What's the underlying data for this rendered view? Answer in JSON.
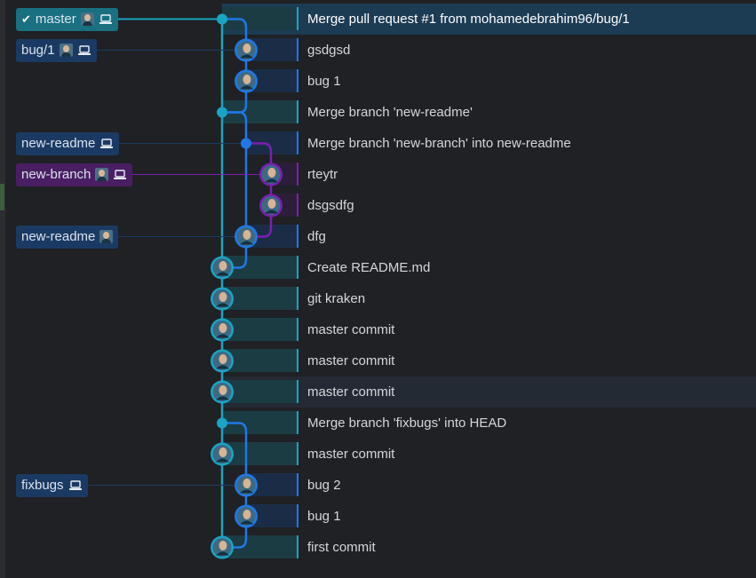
{
  "colors": {
    "background": "#1f2124",
    "lane_master": "#1aa4c4",
    "lane_blue": "#1f78e6",
    "lane_purple": "#7b1fb3",
    "lane_master_cell": "#1c3c44",
    "lane_blue_cell": "#1b2d46",
    "lane_purple_cell": "#2a1e38",
    "tag_master_bg": "#197080",
    "tag_blue_bg": "#1b3a63",
    "tag_purple_bg": "#4a1e63",
    "selected_row_bg": "#1c3c54",
    "hover_row_bg": "#242a33"
  },
  "branch_tags": [
    {
      "row": 0,
      "label": "master",
      "checked": true,
      "avatar": true,
      "laptop": true,
      "kind": "master"
    },
    {
      "row": 1,
      "label": "bug/1",
      "checked": false,
      "avatar": true,
      "laptop": true,
      "kind": "blue"
    },
    {
      "row": 4,
      "label": "new-readme",
      "checked": false,
      "avatar": false,
      "laptop": true,
      "kind": "blue"
    },
    {
      "row": 5,
      "label": "new-branch",
      "checked": false,
      "avatar": true,
      "laptop": true,
      "kind": "purple"
    },
    {
      "row": 7,
      "label": "new-readme",
      "checked": false,
      "avatar": true,
      "laptop": false,
      "kind": "blue"
    },
    {
      "row": 15,
      "label": "fixbugs",
      "checked": false,
      "avatar": false,
      "laptop": true,
      "kind": "blue"
    }
  ],
  "commits": [
    {
      "message": "Merge pull request #1 from mohamedebrahim96/bug/1",
      "lane": 0,
      "merge": true,
      "color": "master",
      "selected": true
    },
    {
      "message": "gsdgsd",
      "lane": 1,
      "merge": false,
      "color": "blue"
    },
    {
      "message": "bug 1",
      "lane": 1,
      "merge": false,
      "color": "blue"
    },
    {
      "message": "Merge branch 'new-readme'",
      "lane": 0,
      "merge": true,
      "color": "master"
    },
    {
      "message": "Merge branch 'new-branch' into new-readme",
      "lane": 1,
      "merge": true,
      "color": "blue"
    },
    {
      "message": "rteytr",
      "lane": 2,
      "merge": false,
      "color": "purple"
    },
    {
      "message": "dsgsdfg",
      "lane": 2,
      "merge": false,
      "color": "purple"
    },
    {
      "message": "dfg",
      "lane": 1,
      "merge": false,
      "color": "blue"
    },
    {
      "message": "Create README.md",
      "lane": 0,
      "merge": false,
      "color": "master"
    },
    {
      "message": "git kraken",
      "lane": 0,
      "merge": false,
      "color": "master"
    },
    {
      "message": "master commit",
      "lane": 0,
      "merge": false,
      "color": "master"
    },
    {
      "message": "master commit",
      "lane": 0,
      "merge": false,
      "color": "master"
    },
    {
      "message": "master commit",
      "lane": 0,
      "merge": false,
      "color": "master",
      "hover": true
    },
    {
      "message": "Merge branch 'fixbugs' into HEAD",
      "lane": 0,
      "merge": true,
      "color": "master"
    },
    {
      "message": "master commit",
      "lane": 0,
      "merge": false,
      "color": "master"
    },
    {
      "message": "bug 2",
      "lane": 1,
      "merge": false,
      "color": "blue"
    },
    {
      "message": "bug 1",
      "lane": 1,
      "merge": false,
      "color": "blue"
    },
    {
      "message": "first commit",
      "lane": 0,
      "merge": false,
      "color": "master"
    }
  ]
}
